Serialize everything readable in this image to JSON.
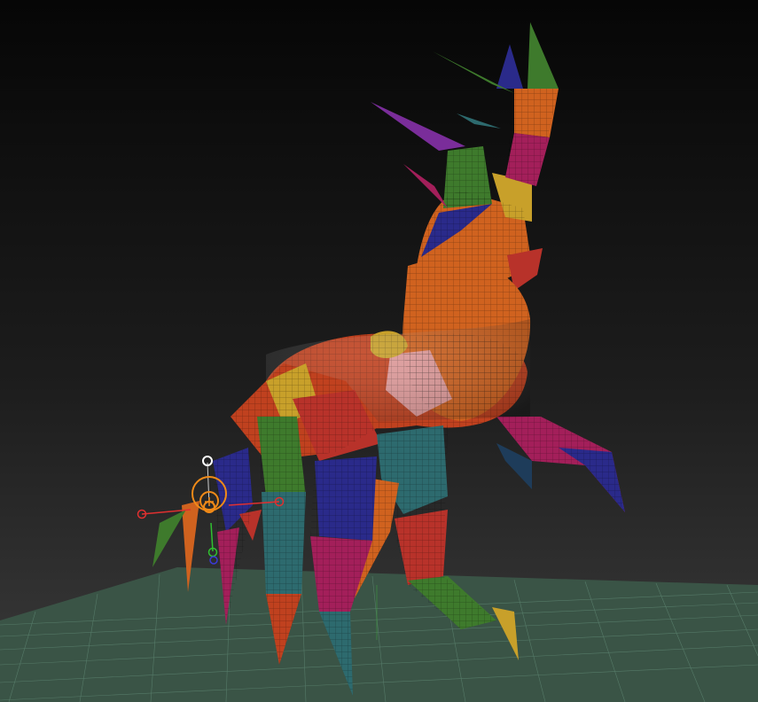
{
  "viewport": {
    "background_top": "#060606",
    "background_bottom": "#3b3b3b",
    "floor_color": "#3a5446",
    "floor_grid_color": "#6c9a84"
  },
  "model": {
    "polygroup_colors": [
      "#c0411f",
      "#d0621f",
      "#2d6a6e",
      "#a31f5a",
      "#2a2a8a",
      "#3e7a2c",
      "#c8a02a",
      "#7a2d9a",
      "#b8322a",
      "#e09a9a"
    ]
  },
  "gizmo": {
    "icons": [
      "move-ring-icon",
      "rotate-ring-icon",
      "axis-x-icon",
      "axis-y-icon",
      "axis-z-icon",
      "lock-icon"
    ],
    "colors": {
      "ring": "#f08a18",
      "x": "#e03030",
      "y": "#30c030",
      "z": "#3a3ad8",
      "center": "#ffffff"
    }
  }
}
